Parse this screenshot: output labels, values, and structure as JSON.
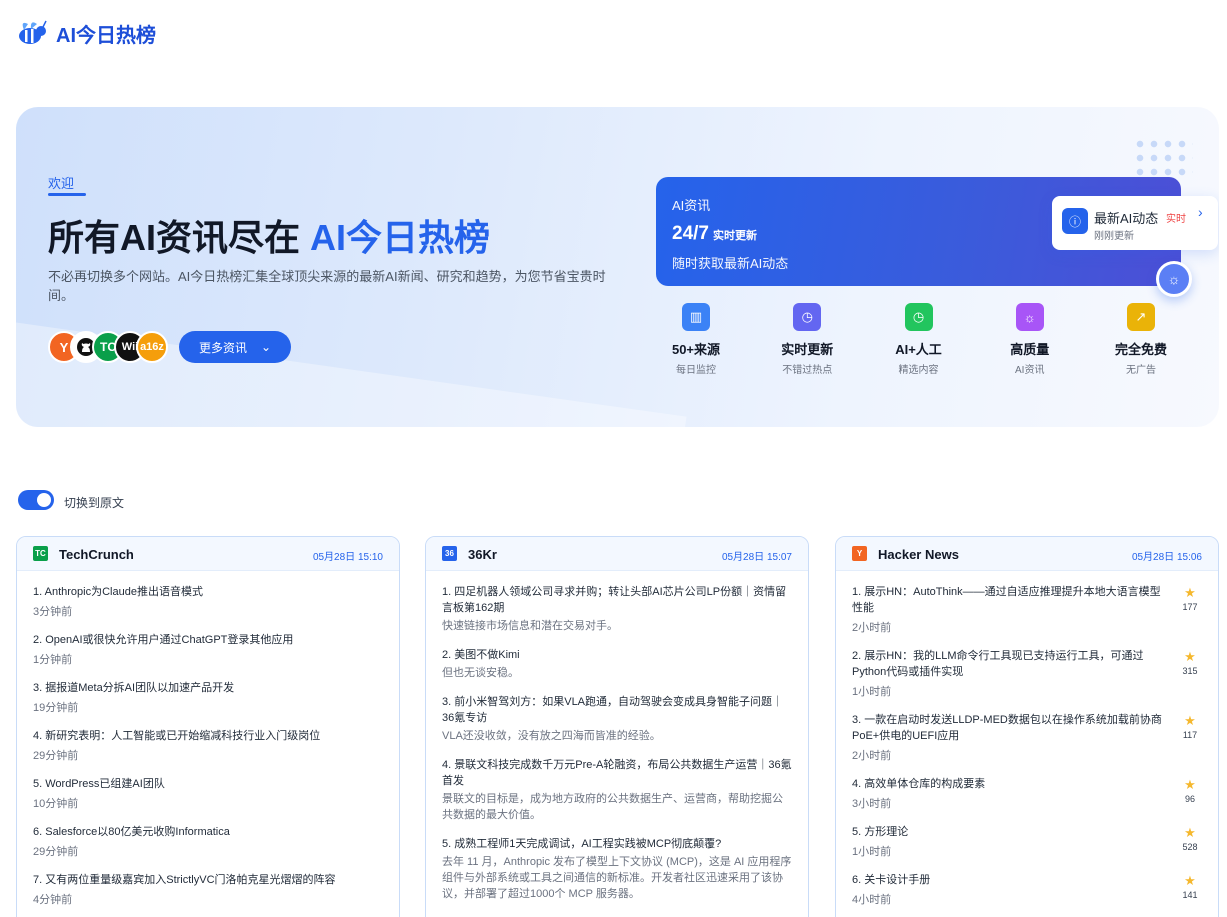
{
  "brand": {
    "name": "AI今日热榜"
  },
  "hero": {
    "welcome": "欢迎",
    "title_prefix": "所有AI资讯尽在 ",
    "title_highlight": "AI今日热榜",
    "description": "不必再切换多个网站。AI今日热榜汇集全球顶尖来源的最新AI新闻、研究和趋势，为您节省宝贵时间。",
    "avatars": [
      "Y",
      "",
      "TC",
      "Wii",
      "a16z"
    ],
    "more_button": "更多资讯",
    "ai_card": {
      "label": "AI资讯",
      "big": "24/7",
      "big_suffix": "实时更新",
      "subtitle": "随时获取最新AI动态"
    },
    "notification": {
      "title": "最新AI动态",
      "badge": "实时",
      "subtitle": "刚刚更新"
    },
    "features": [
      {
        "label": "50+来源",
        "sub": "每日监控",
        "color": "#3b82f6",
        "icon": "chart-icon"
      },
      {
        "label": "实时更新",
        "sub": "不错过热点",
        "color": "#6366f1",
        "icon": "clock-icon"
      },
      {
        "label": "AI+人工",
        "sub": "精选内容",
        "color": "#22c55e",
        "icon": "clock-icon"
      },
      {
        "label": "高质量",
        "sub": "AI资讯",
        "color": "#a855f7",
        "icon": "bulb-icon"
      },
      {
        "label": "完全免费",
        "sub": "无广告",
        "color": "#eab308",
        "icon": "trend-icon"
      }
    ]
  },
  "toggle": {
    "label": "切换到原文"
  },
  "cards": [
    {
      "name": "TechCrunch",
      "logo": "TC",
      "logo_color": "#0a9f4a",
      "time": "05月28日 15:10",
      "items": [
        {
          "title": "1. Anthropic为Claude推出语音模式",
          "time": "3分钟前"
        },
        {
          "title": "2. OpenAI或很快允许用户通过ChatGPT登录其他应用",
          "time": "1分钟前"
        },
        {
          "title": "3. 据报道Meta分拆AI团队以加速产品开发",
          "time": "19分钟前"
        },
        {
          "title": "4. 新研究表明：人工智能或已开始缩减科技行业入门级岗位",
          "time": "29分钟前"
        },
        {
          "title": "5. WordPress已组建AI团队",
          "time": "10分钟前"
        },
        {
          "title": "6. Salesforce以80亿美元收购Informatica",
          "time": "29分钟前"
        },
        {
          "title": "7. 又有两位重量级嘉宾加入StrictlyVC门洛帕克星光熠熠的阵容",
          "time": "4分钟前"
        }
      ]
    },
    {
      "name": "36Kr",
      "logo": "36",
      "logo_color": "#2563eb",
      "time": "05月28日 15:07",
      "items": [
        {
          "title": "1. 四足机器人领域公司寻求并购；转让头部AI芯片公司LP份额｜资情留言板第162期",
          "sub": "快速链接市场信息和潜在交易对手。"
        },
        {
          "title": "2. 美图不做Kimi",
          "sub": "但也无谈安稳。"
        },
        {
          "title": "3. 前小米智驾刘方：如果VLA跑通，自动驾驶会变成具身智能子问题｜36氪专访",
          "sub": "VLA还没收敛，没有放之四海而皆准的经验。"
        },
        {
          "title": "4. 景联文科技完成数千万元Pre-A轮融资，布局公共数据生产运营｜36氪首发",
          "sub": "景联文的目标是，成为地方政府的公共数据生产、运营商，帮助挖掘公共数据的最大价值。"
        },
        {
          "title": "5. 成熟工程师1天完成调试，AI工程实践被MCP彻底颠覆?",
          "sub": "去年 11 月，Anthropic 发布了模型上下文协议 (MCP)，这是 AI 应用程序组件与外部系统或工具之间通信的新标准。开发者社区迅速采用了该协议，并部署了超过1000个 MCP 服务器。"
        }
      ]
    },
    {
      "name": "Hacker News",
      "logo": "Y",
      "logo_color": "#f26522",
      "time": "05月28日 15:06",
      "items": [
        {
          "title": "1. 展示HN：AutoThink——通过自适应推理提升本地大语言模型性能",
          "time": "2小时前",
          "score": "177"
        },
        {
          "title": "2. 展示HN：我的LLM命令行工具现已支持运行工具，可通过Python代码或插件实现",
          "time": "1小时前",
          "score": "315"
        },
        {
          "title": "3. 一款在启动时发送LLDP-MED数据包以在操作系统加载前协商PoE+供电的UEFI应用",
          "time": "2小时前",
          "score": "117"
        },
        {
          "title": "4. 高效单体仓库的构成要素",
          "time": "3小时前",
          "score": "96"
        },
        {
          "title": "5. 方形理论",
          "time": "1小时前",
          "score": "528"
        },
        {
          "title": "6. 关卡设计手册",
          "time": "4小时前",
          "score": "141"
        }
      ]
    }
  ]
}
